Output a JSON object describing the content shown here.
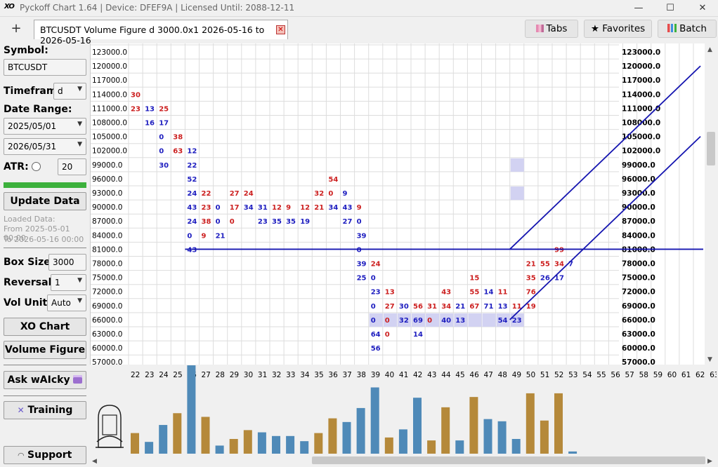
{
  "app": {
    "title": "Pyckoff Chart 1.64 | Device: DFEF9A | Licensed Until: 2088-12-11",
    "logo": "XO",
    "minimize": "—",
    "maximize": "☐",
    "close": "✕"
  },
  "tabbar": {
    "new_tab": "+",
    "active_tab": "BTCUSDT Volume Figure d 3000.0x1 2026-05-16 to 2026-05-16",
    "close": "✕",
    "tabs_btn": "Tabs",
    "favorites_btn": "★ Favorites",
    "batch_btn": "Batch"
  },
  "sidebar": {
    "symbol_label": "Symbol:",
    "symbol_value": "BTCUSDT",
    "timeframe_label": "Timefram",
    "timeframe_value": "d",
    "date_range_label": "Date Range:",
    "date_from": "2025/05/01",
    "date_to": "2026/05/31",
    "atr_label": "ATR:",
    "atr_value": "20",
    "update_btn": "Update Data",
    "loaded_title": "Loaded Data:",
    "loaded_from": "From 2025-05-01 00:00",
    "loaded_to": "To 2026-05-16 00:00",
    "box_size_label": "Box Size:",
    "box_size_value": "3000",
    "reversal_label": "Reversal:",
    "reversal_value": "1",
    "vol_unit_label": "Vol Unit:",
    "vol_unit_value": "Auto",
    "xo_chart_btn": "XO Chart",
    "volume_figure_btn": "Volume Figure",
    "ask_btn": "Ask wAIcky",
    "training_btn": "Training",
    "support_btn": "Support"
  },
  "chart_data": {
    "type": "table",
    "price_levels": [
      123000.0,
      120000.0,
      117000.0,
      114000.0,
      111000.0,
      108000.0,
      105000.0,
      102000.0,
      99000.0,
      96000.0,
      93000.0,
      90000.0,
      87000.0,
      84000.0,
      81000.0,
      78000.0,
      75000.0,
      72000.0,
      69000.0,
      66000.0,
      63000.0,
      60000.0,
      57000.0
    ],
    "column_labels": [
      22,
      23,
      24,
      25,
      26,
      27,
      28,
      29,
      30,
      31,
      32,
      33,
      34,
      35,
      36,
      37,
      38,
      39,
      40,
      41,
      42,
      43,
      44,
      45,
      46,
      47,
      48,
      49,
      50,
      51,
      52,
      53,
      54,
      55,
      56,
      57,
      58,
      59,
      60,
      61,
      62,
      63
    ],
    "cells": [
      {
        "col": 22,
        "price": 114000,
        "v": "30",
        "c": "red"
      },
      {
        "col": 22,
        "price": 111000,
        "v": "23",
        "c": "red"
      },
      {
        "col": 23,
        "price": 111000,
        "v": "13",
        "c": "blue"
      },
      {
        "col": 23,
        "price": 108000,
        "v": "16",
        "c": "blue"
      },
      {
        "col": 24,
        "price": 111000,
        "v": "25",
        "c": "red"
      },
      {
        "col": 24,
        "price": 108000,
        "v": "17",
        "c": "blue"
      },
      {
        "col": 24,
        "price": 105000,
        "v": "0",
        "c": "blue"
      },
      {
        "col": 24,
        "price": 102000,
        "v": "0",
        "c": "blue"
      },
      {
        "col": 24,
        "price": 99000,
        "v": "30",
        "c": "blue"
      },
      {
        "col": 25,
        "price": 105000,
        "v": "38",
        "c": "red"
      },
      {
        "col": 25,
        "price": 102000,
        "v": "63",
        "c": "red"
      },
      {
        "col": 26,
        "price": 102000,
        "v": "12",
        "c": "blue"
      },
      {
        "col": 26,
        "price": 99000,
        "v": "22",
        "c": "blue"
      },
      {
        "col": 26,
        "price": 96000,
        "v": "52",
        "c": "blue"
      },
      {
        "col": 26,
        "price": 93000,
        "v": "24",
        "c": "blue"
      },
      {
        "col": 26,
        "price": 90000,
        "v": "43",
        "c": "blue"
      },
      {
        "col": 26,
        "price": 87000,
        "v": "24",
        "c": "blue"
      },
      {
        "col": 26,
        "price": 84000,
        "v": "0",
        "c": "blue"
      },
      {
        "col": 26,
        "price": 81000,
        "v": "43",
        "c": "blue"
      },
      {
        "col": 27,
        "price": 93000,
        "v": "22",
        "c": "red"
      },
      {
        "col": 27,
        "price": 90000,
        "v": "23",
        "c": "red"
      },
      {
        "col": 27,
        "price": 87000,
        "v": "38",
        "c": "red"
      },
      {
        "col": 27,
        "price": 84000,
        "v": "9",
        "c": "red"
      },
      {
        "col": 28,
        "price": 90000,
        "v": "0",
        "c": "blue"
      },
      {
        "col": 28,
        "price": 87000,
        "v": "0",
        "c": "blue"
      },
      {
        "col": 28,
        "price": 84000,
        "v": "21",
        "c": "blue"
      },
      {
        "col": 29,
        "price": 93000,
        "v": "27",
        "c": "red"
      },
      {
        "col": 29,
        "price": 90000,
        "v": "17",
        "c": "red"
      },
      {
        "col": 29,
        "price": 87000,
        "v": "0",
        "c": "red"
      },
      {
        "col": 30,
        "price": 93000,
        "v": "24",
        "c": "red"
      },
      {
        "col": 30,
        "price": 90000,
        "v": "34",
        "c": "blue"
      },
      {
        "col": 31,
        "price": 90000,
        "v": "31",
        "c": "blue"
      },
      {
        "col": 31,
        "price": 87000,
        "v": "23",
        "c": "blue"
      },
      {
        "col": 32,
        "price": 90000,
        "v": "12",
        "c": "red"
      },
      {
        "col": 32,
        "price": 87000,
        "v": "35",
        "c": "blue"
      },
      {
        "col": 33,
        "price": 90000,
        "v": "9",
        "c": "red"
      },
      {
        "col": 33,
        "price": 87000,
        "v": "35",
        "c": "blue"
      },
      {
        "col": 34,
        "price": 90000,
        "v": "12",
        "c": "red"
      },
      {
        "col": 34,
        "price": 87000,
        "v": "19",
        "c": "blue"
      },
      {
        "col": 35,
        "price": 93000,
        "v": "32",
        "c": "red"
      },
      {
        "col": 35,
        "price": 90000,
        "v": "21",
        "c": "red"
      },
      {
        "col": 36,
        "price": 96000,
        "v": "54",
        "c": "red"
      },
      {
        "col": 36,
        "price": 93000,
        "v": "0",
        "c": "red"
      },
      {
        "col": 36,
        "price": 90000,
        "v": "34",
        "c": "blue"
      },
      {
        "col": 37,
        "price": 93000,
        "v": "9",
        "c": "blue"
      },
      {
        "col": 37,
        "price": 90000,
        "v": "43",
        "c": "blue"
      },
      {
        "col": 37,
        "price": 87000,
        "v": "27",
        "c": "blue"
      },
      {
        "col": 38,
        "price": 90000,
        "v": "9",
        "c": "red"
      },
      {
        "col": 38,
        "price": 87000,
        "v": "0",
        "c": "blue"
      },
      {
        "col": 38,
        "price": 84000,
        "v": "39",
        "c": "blue"
      },
      {
        "col": 38,
        "price": 81000,
        "v": "0",
        "c": "blue"
      },
      {
        "col": 38,
        "price": 78000,
        "v": "39",
        "c": "blue"
      },
      {
        "col": 38,
        "price": 75000,
        "v": "25",
        "c": "blue"
      },
      {
        "col": 39,
        "price": 78000,
        "v": "24",
        "c": "red"
      },
      {
        "col": 39,
        "price": 75000,
        "v": "0",
        "c": "blue"
      },
      {
        "col": 39,
        "price": 72000,
        "v": "23",
        "c": "blue"
      },
      {
        "col": 39,
        "price": 69000,
        "v": "0",
        "c": "blue"
      },
      {
        "col": 39,
        "price": 66000,
        "v": "0",
        "c": "blue"
      },
      {
        "col": 39,
        "price": 63000,
        "v": "64",
        "c": "blue"
      },
      {
        "col": 39,
        "price": 60000,
        "v": "56",
        "c": "blue"
      },
      {
        "col": 40,
        "price": 72000,
        "v": "13",
        "c": "red"
      },
      {
        "col": 40,
        "price": 69000,
        "v": "27",
        "c": "red"
      },
      {
        "col": 40,
        "price": 66000,
        "v": "0",
        "c": "red"
      },
      {
        "col": 40,
        "price": 63000,
        "v": "0",
        "c": "red"
      },
      {
        "col": 41,
        "price": 69000,
        "v": "30",
        "c": "blue"
      },
      {
        "col": 41,
        "price": 66000,
        "v": "32",
        "c": "blue"
      },
      {
        "col": 42,
        "price": 69000,
        "v": "56",
        "c": "red"
      },
      {
        "col": 42,
        "price": 66000,
        "v": "69",
        "c": "blue"
      },
      {
        "col": 42,
        "price": 63000,
        "v": "14",
        "c": "blue"
      },
      {
        "col": 43,
        "price": 69000,
        "v": "31",
        "c": "red"
      },
      {
        "col": 43,
        "price": 66000,
        "v": "0",
        "c": "red"
      },
      {
        "col": 44,
        "price": 72000,
        "v": "43",
        "c": "red"
      },
      {
        "col": 44,
        "price": 69000,
        "v": "34",
        "c": "red"
      },
      {
        "col": 44,
        "price": 66000,
        "v": "40",
        "c": "blue"
      },
      {
        "col": 45,
        "price": 69000,
        "v": "21",
        "c": "blue"
      },
      {
        "col": 45,
        "price": 66000,
        "v": "13",
        "c": "blue"
      },
      {
        "col": 46,
        "price": 75000,
        "v": "15",
        "c": "red"
      },
      {
        "col": 46,
        "price": 72000,
        "v": "55",
        "c": "red"
      },
      {
        "col": 46,
        "price": 69000,
        "v": "67",
        "c": "red"
      },
      {
        "col": 47,
        "price": 72000,
        "v": "14",
        "c": "blue"
      },
      {
        "col": 47,
        "price": 69000,
        "v": "71",
        "c": "blue"
      },
      {
        "col": 48,
        "price": 72000,
        "v": "11",
        "c": "red"
      },
      {
        "col": 48,
        "price": 69000,
        "v": "13",
        "c": "blue"
      },
      {
        "col": 48,
        "price": 66000,
        "v": "54",
        "c": "blue"
      },
      {
        "col": 49,
        "price": 69000,
        "v": "11",
        "c": "red"
      },
      {
        "col": 49,
        "price": 66000,
        "v": "23",
        "c": "blue"
      },
      {
        "col": 50,
        "price": 78000,
        "v": "21",
        "c": "red"
      },
      {
        "col": 50,
        "price": 75000,
        "v": "35",
        "c": "red"
      },
      {
        "col": 50,
        "price": 72000,
        "v": "76",
        "c": "red"
      },
      {
        "col": 50,
        "price": 69000,
        "v": "19",
        "c": "red"
      },
      {
        "col": 51,
        "price": 78000,
        "v": "55",
        "c": "red"
      },
      {
        "col": 51,
        "price": 75000,
        "v": "26",
        "c": "blue"
      },
      {
        "col": 52,
        "price": 81000,
        "v": "99",
        "c": "red"
      },
      {
        "col": 52,
        "price": 78000,
        "v": "34",
        "c": "red"
      },
      {
        "col": 52,
        "price": 75000,
        "v": "17",
        "c": "blue"
      },
      {
        "col": 53,
        "price": 78000,
        "v": "7",
        "c": "blue"
      }
    ],
    "highlight_cells": [
      {
        "col": 49,
        "price": 99000
      },
      {
        "col": 49,
        "price": 93000
      },
      {
        "col": 39,
        "price": 66000
      },
      {
        "col": 40,
        "price": 66000
      },
      {
        "col": 41,
        "price": 66000
      },
      {
        "col": 42,
        "price": 66000
      },
      {
        "col": 43,
        "price": 66000
      },
      {
        "col": 44,
        "price": 66000
      },
      {
        "col": 45,
        "price": 66000
      },
      {
        "col": 46,
        "price": 66000
      },
      {
        "col": 47,
        "price": 66000
      },
      {
        "col": 48,
        "price": 66000
      },
      {
        "col": 49,
        "price": 66000
      }
    ],
    "volume_bars": [
      {
        "col": 22,
        "value": 28,
        "c": "gold"
      },
      {
        "col": 23,
        "value": 16,
        "c": "steel"
      },
      {
        "col": 24,
        "value": 39,
        "c": "steel"
      },
      {
        "col": 25,
        "value": 55,
        "c": "gold"
      },
      {
        "col": 26,
        "value": 120,
        "c": "steel"
      },
      {
        "col": 27,
        "value": 50,
        "c": "gold"
      },
      {
        "col": 28,
        "value": 11,
        "c": "steel"
      },
      {
        "col": 29,
        "value": 20,
        "c": "gold"
      },
      {
        "col": 30,
        "value": 32,
        "c": "gold"
      },
      {
        "col": 31,
        "value": 29,
        "c": "steel"
      },
      {
        "col": 32,
        "value": 24,
        "c": "steel"
      },
      {
        "col": 33,
        "value": 24,
        "c": "steel"
      },
      {
        "col": 34,
        "value": 17,
        "c": "steel"
      },
      {
        "col": 35,
        "value": 28,
        "c": "gold"
      },
      {
        "col": 36,
        "value": 48,
        "c": "gold"
      },
      {
        "col": 37,
        "value": 43,
        "c": "steel"
      },
      {
        "col": 38,
        "value": 62,
        "c": "steel"
      },
      {
        "col": 39,
        "value": 90,
        "c": "steel"
      },
      {
        "col": 40,
        "value": 22,
        "c": "gold"
      },
      {
        "col": 41,
        "value": 33,
        "c": "steel"
      },
      {
        "col": 42,
        "value": 76,
        "c": "steel"
      },
      {
        "col": 43,
        "value": 18,
        "c": "gold"
      },
      {
        "col": 44,
        "value": 63,
        "c": "gold"
      },
      {
        "col": 45,
        "value": 18,
        "c": "steel"
      },
      {
        "col": 46,
        "value": 77,
        "c": "gold"
      },
      {
        "col": 47,
        "value": 47,
        "c": "steel"
      },
      {
        "col": 48,
        "value": 44,
        "c": "steel"
      },
      {
        "col": 49,
        "value": 20,
        "c": "steel"
      },
      {
        "col": 50,
        "value": 82,
        "c": "gold"
      },
      {
        "col": 51,
        "value": 45,
        "c": "gold"
      },
      {
        "col": 52,
        "value": 82,
        "c": "gold"
      },
      {
        "col": 53,
        "value": 3,
        "c": "steel"
      }
    ],
    "trendlines": [
      {
        "from": {
          "col": 26,
          "price": 79500
        },
        "to": {
          "col": 63.5,
          "price": 79500
        }
      },
      {
        "from": {
          "col": 49,
          "price": 79500
        },
        "to": {
          "col": 62.5,
          "price": 118500
        }
      },
      {
        "from": {
          "col": 49,
          "price": 64500
        },
        "to": {
          "col": 62.5,
          "price": 103500
        }
      }
    ],
    "colors": {
      "red": "#cc1f1f",
      "blue": "#1d1dbf",
      "gold": "#b5893a",
      "steel": "#4f8ab8",
      "line": "#1515b0",
      "highlight": "#d2d2f2"
    }
  }
}
